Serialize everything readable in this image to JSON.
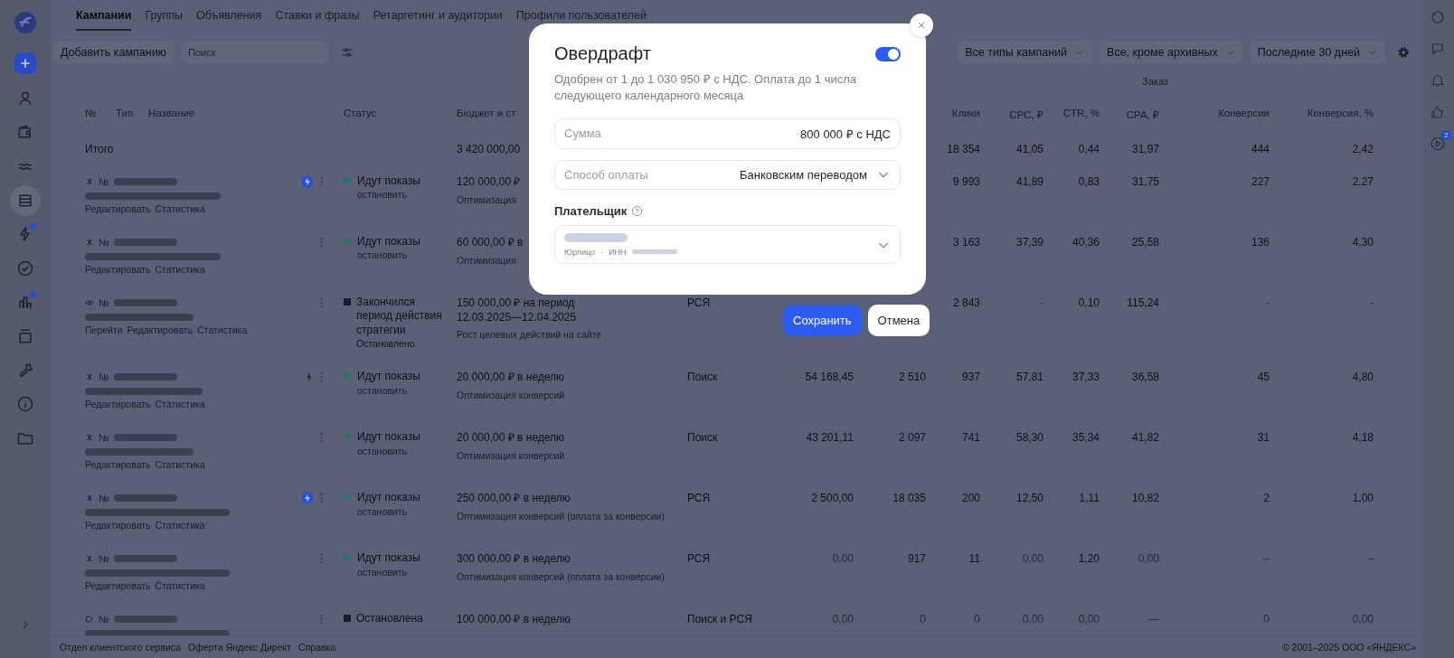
{
  "sidebar": {
    "items": [
      {
        "kind": "person",
        "selected": false
      },
      {
        "kind": "wallet",
        "selected": false
      },
      {
        "kind": "waves",
        "selected": false
      },
      {
        "kind": "database",
        "selected": true
      },
      {
        "kind": "lightning",
        "selected": false
      },
      {
        "kind": "check",
        "selected": false
      },
      {
        "kind": "chart",
        "selected": false
      },
      {
        "kind": "layers",
        "selected": false
      },
      {
        "kind": "wrench",
        "selected": false
      },
      {
        "kind": "info",
        "selected": false
      },
      {
        "kind": "folder",
        "selected": false
      }
    ]
  },
  "tabs": [
    {
      "label": "Кампании",
      "selected": true
    },
    {
      "label": "Группы",
      "selected": false
    },
    {
      "label": "Объявления",
      "selected": false
    },
    {
      "label": "Ставки и фразы",
      "selected": false
    },
    {
      "label": "Ретаргетинг и аудитории",
      "selected": false
    },
    {
      "label": "Профили пользователей",
      "selected": false
    }
  ],
  "toolbar": {
    "add_button": "Добавить кампанию",
    "search": {
      "placeholder": "Поиск"
    },
    "filters": [
      "Все типы кампаний",
      "Все, кроме архивных",
      "Последние 30 дней"
    ]
  },
  "right_rail": {
    "items": [
      {
        "kind": "emoji"
      },
      {
        "kind": "chat"
      },
      {
        "kind": "bell"
      },
      {
        "kind": "like"
      },
      {
        "kind": "play",
        "badge": "2"
      }
    ]
  },
  "table": {
    "group_header": "Заказ",
    "columns": {
      "left": [
        "№",
        "Тип",
        "Название",
        "Статус",
        "Бюджет и ст"
      ],
      "metrics": [
        "Клики",
        "CPC, ₽",
        "CTR, %",
        "CPA, ₽",
        "Конверсии",
        "Конверсия, %"
      ]
    },
    "total": {
      "label": "Итого",
      "budget": "3 420 000,00",
      "metrics": [
        {
          "value": "18 354",
          "muted": false
        },
        {
          "value": "41,05",
          "muted": false
        },
        {
          "value": "0,44",
          "muted": false
        },
        {
          "value": "31,97",
          "muted": false
        },
        {
          "value": "444",
          "muted": false
        },
        {
          "value": "2,42",
          "muted": false
        }
      ]
    },
    "rows": [
      {
        "number": "№",
        "links": [
          "Редактировать",
          "Статистика"
        ],
        "status": {
          "kind": "active",
          "lines": [
            "Идут показы"
          ],
          "note": "остановить"
        },
        "budget": "120 000,00 ₽",
        "strategy": "Оптимизация",
        "metrics": [
          {
            "value": "9 993",
            "muted": false
          },
          {
            "value": "41,89",
            "muted": false
          },
          {
            "value": "0,83",
            "muted": false
          },
          {
            "value": "31,75",
            "muted": false
          },
          {
            "value": "227",
            "muted": false
          },
          {
            "value": "2,27",
            "muted": false
          }
        ]
      },
      {
        "number": "№",
        "links": [
          "Редактировать",
          "Статистика"
        ],
        "status": {
          "kind": "active",
          "lines": [
            "Идут показы"
          ],
          "note": "остановить"
        },
        "budget": "60 000,00 ₽ в",
        "strategy": "Оптимизация",
        "metrics": [
          {
            "value": "3 163",
            "muted": false
          },
          {
            "value": "37,39",
            "muted": false
          },
          {
            "value": "40,36",
            "muted": false
          },
          {
            "value": "25,58",
            "muted": false
          },
          {
            "value": "136",
            "muted": false
          },
          {
            "value": "4,30",
            "muted": false
          }
        ]
      },
      {
        "number": "№",
        "links": [
          "Перейти",
          "Редактировать",
          "Статистика"
        ],
        "status": {
          "kind": "stopped",
          "lines": [
            "Закончился",
            "период действия",
            "стратегии"
          ],
          "note": "Остановлено"
        },
        "budget": "150 000,00 ₽ на период 12.03.2025—12.04.2025",
        "strategy": "Рост целевых действий на сайте",
        "type": "РСЯ",
        "metrics": [
          {
            "value": "2 843",
            "muted": false
          },
          {
            "value": "-",
            "muted": true
          },
          {
            "value": "0,10",
            "muted": false
          },
          {
            "value": "115,24",
            "muted": false
          },
          {
            "value": "-",
            "muted": true
          },
          {
            "value": "-",
            "muted": true
          }
        ]
      },
      {
        "number": "№",
        "links": [
          "Редактировать",
          "Статистика"
        ],
        "status": {
          "kind": "active",
          "lines": [
            "Идут показы"
          ],
          "note": "остановить"
        },
        "budget": "20 000,00 ₽ в неделю",
        "strategy": "Оптимизация конверсий",
        "type": "Поиск",
        "spend": {
          "value": "54 168,45",
          "muted": false
        },
        "impressions": {
          "value": "2 510",
          "muted": false
        },
        "metrics": [
          {
            "value": "937",
            "muted": false
          },
          {
            "value": "57,81",
            "muted": false
          },
          {
            "value": "37,33",
            "muted": false
          },
          {
            "value": "36,58",
            "muted": false
          },
          {
            "value": "45",
            "muted": false
          },
          {
            "value": "4,80",
            "muted": false
          }
        ]
      },
      {
        "number": "№",
        "links": [
          "Редактировать",
          "Статистика"
        ],
        "status": {
          "kind": "active",
          "lines": [
            "Идут показы"
          ],
          "note": "остановить"
        },
        "budget": "20 000,00 ₽ в неделю",
        "strategy": "Оптимизация конверсий",
        "type": "Поиск",
        "spend": {
          "value": "43 201,11",
          "muted": false
        },
        "impressions": {
          "value": "2 097",
          "muted": false
        },
        "metrics": [
          {
            "value": "741",
            "muted": false
          },
          {
            "value": "58,30",
            "muted": false
          },
          {
            "value": "35,34",
            "muted": false
          },
          {
            "value": "41,82",
            "muted": false
          },
          {
            "value": "31",
            "muted": false
          },
          {
            "value": "4,18",
            "muted": false
          }
        ]
      },
      {
        "number": "№",
        "links": [
          "Редактировать",
          "Статистика"
        ],
        "status": {
          "kind": "active",
          "lines": [
            "Идут показы"
          ],
          "note": "остановить"
        },
        "budget": "250 000,00 ₽ в неделю",
        "strategy": "Оптимизация конверсий (оплата за конверсии)",
        "type": "РСЯ",
        "spend": {
          "value": "2 500,00",
          "muted": false
        },
        "impressions": {
          "value": "18 035",
          "muted": false
        },
        "metrics": [
          {
            "value": "200",
            "muted": false
          },
          {
            "value": "12,50",
            "muted": false
          },
          {
            "value": "1,11",
            "muted": false
          },
          {
            "value": "10,82",
            "muted": false
          },
          {
            "value": "2",
            "muted": false
          },
          {
            "value": "1,00",
            "muted": false
          }
        ]
      },
      {
        "number": "№",
        "links": [
          "Редактировать",
          "Статистика"
        ],
        "status": {
          "kind": "active",
          "lines": [
            "Идут показы"
          ],
          "note": "остановить"
        },
        "budget": "300 000,00 ₽ в неделю",
        "strategy": "Оптимизация конверсий (оплата за конверсии)",
        "type": "РСЯ",
        "spend": {
          "value": "0,00",
          "muted": true
        },
        "impressions": {
          "value": "917",
          "muted": false
        },
        "metrics": [
          {
            "value": "11",
            "muted": false
          },
          {
            "value": "0,00",
            "muted": true
          },
          {
            "value": "1,20",
            "muted": false
          },
          {
            "value": "0,00",
            "muted": true
          },
          {
            "value": "–",
            "muted": true
          },
          {
            "value": "–",
            "muted": true
          }
        ]
      },
      {
        "number": "№",
        "status": {
          "kind": "stopped",
          "lines": [
            "Остановлена"
          ]
        },
        "budget": "100 000,00 ₽ в неделю",
        "type": "Поиск и РСЯ",
        "spend": {
          "value": "0,00",
          "muted": true
        },
        "impressions": {
          "value": "0",
          "muted": true
        },
        "metrics": [
          {
            "value": "0",
            "muted": true
          },
          {
            "value": "0,00",
            "muted": true
          },
          {
            "value": "0,00",
            "muted": true
          },
          {
            "value": "—",
            "muted": true
          },
          {
            "value": "0",
            "muted": true
          },
          {
            "value": "0,00",
            "muted": true
          }
        ]
      }
    ]
  },
  "footer": {
    "links": [
      "Отдел клиентского сервиса",
      "Оферта Яндекс Директ",
      "Справка"
    ],
    "copyright": "© 2001–2025 ООО «ЯНДЕКС»"
  },
  "dialog": {
    "title": "Овердрафт",
    "enabled": true,
    "description": "Одобрен от 1 до 1 030 950 ₽ с НДС. Оплата до 1 числа следующего календарного месяца",
    "amount": {
      "label": "Сумма",
      "value": "800 000  ₽ с НДС"
    },
    "payment": {
      "label": "Способ оплаты",
      "value": "Банковским переводом"
    },
    "payer": {
      "label": "Плательщик",
      "detail": "Юрлицо",
      "separator": "·",
      "inn_label": "ИНН"
    },
    "buttons": [
      {
        "label": "Сохранить",
        "kind": "primary"
      },
      {
        "label": "Отмена",
        "kind": "secondary"
      }
    ]
  }
}
